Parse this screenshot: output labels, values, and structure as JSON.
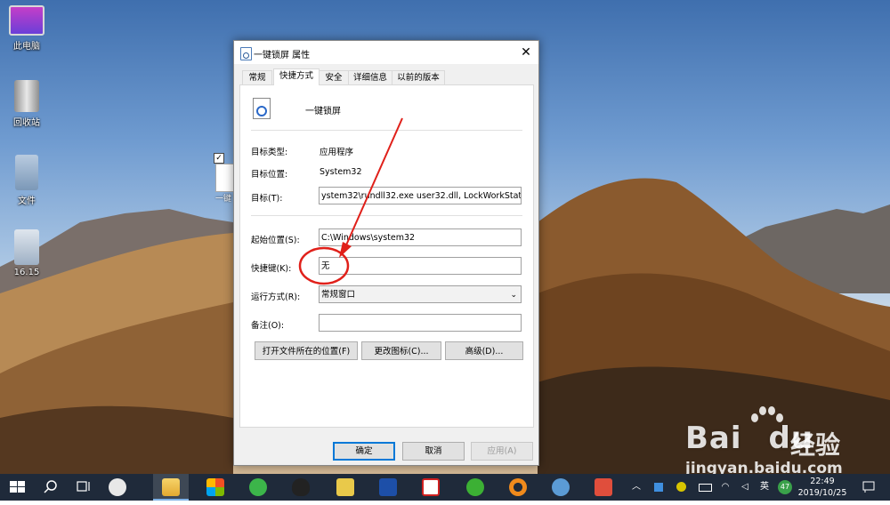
{
  "desktop": {
    "icons": [
      {
        "label": "此电脑"
      },
      {
        "label": "回收站"
      },
      {
        "label": "文件"
      },
      {
        "label": "16.15"
      }
    ],
    "selected_icon_label": "一键"
  },
  "dialog": {
    "title": "一键锁屏 属性",
    "close_glyph": "✕",
    "tabs": [
      "常规",
      "快捷方式",
      "安全",
      "详细信息",
      "以前的版本"
    ],
    "active_tab": "快捷方式",
    "app_name": "一键锁屏",
    "fields": {
      "target_type_label": "目标类型:",
      "target_type_value": "应用程序",
      "target_location_label": "目标位置:",
      "target_location_value": "System32",
      "target_label": "目标(T):",
      "target_value": "ystem32\\rundll32.exe user32.dll, LockWorkStation",
      "start_in_label": "起始位置(S):",
      "start_in_value": "C:\\Windows\\system32",
      "shortcut_key_label": "快捷键(K):",
      "shortcut_key_value": "无",
      "run_label": "运行方式(R):",
      "run_value": "常规窗口",
      "comment_label": "备注(O):",
      "comment_value": ""
    },
    "buttons": {
      "open_location": "打开文件所在的位置(F)",
      "change_icon": "更改图标(C)...",
      "advanced": "高级(D)...",
      "ok": "确定",
      "cancel": "取消",
      "apply": "应用(A)"
    }
  },
  "watermark": {
    "brand": "Bai",
    "brand2": "du",
    "cn": "经验",
    "url": "jingyan.baidu.com"
  },
  "taskbar": {
    "ime": "英",
    "badge": "47",
    "time": "22:49",
    "date": "2019/10/25",
    "accent": "#1f2a3a"
  },
  "annotation_color": "#e0201a"
}
